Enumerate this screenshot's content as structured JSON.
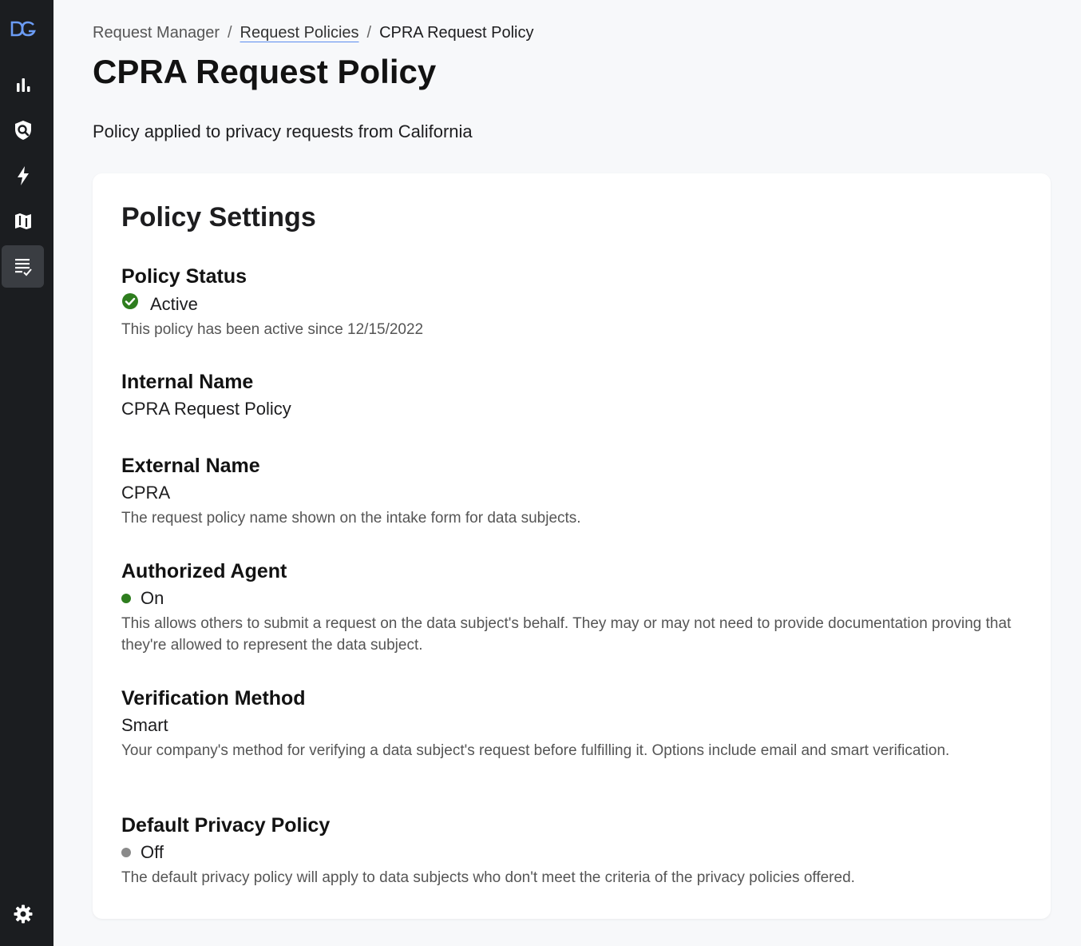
{
  "colors": {
    "sidebar_bg": "#1b1d20",
    "accent": "#5b8def",
    "status_active": "#2e7d1e",
    "status_off": "#8a8a8a"
  },
  "sidebar": {
    "logo_icon": "dg-logo-icon",
    "items": [
      {
        "icon": "bar-chart-icon",
        "active": false
      },
      {
        "icon": "shield-search-icon",
        "active": false
      },
      {
        "icon": "lightning-icon",
        "active": false
      },
      {
        "icon": "map-icon",
        "active": false
      },
      {
        "icon": "checklist-icon",
        "active": true
      }
    ],
    "footer_icon": "gear-icon"
  },
  "breadcrumb": {
    "root": "Request Manager",
    "parent": "Request Policies",
    "current": "CPRA Request Policy",
    "separator": "/"
  },
  "page": {
    "title": "CPRA Request Policy",
    "description": "Policy applied to privacy requests from California"
  },
  "settings": {
    "title": "Policy Settings",
    "status": {
      "label": "Policy Status",
      "value": "Active",
      "help": "This policy has been active since 12/15/2022"
    },
    "internal_name": {
      "label": "Internal Name",
      "value": "CPRA Request Policy"
    },
    "external_name": {
      "label": "External Name",
      "value": "CPRA",
      "help": "The request policy name shown on the intake form for data subjects."
    },
    "authorized_agent": {
      "label": "Authorized Agent",
      "value": "On",
      "help": "This allows others to submit a request on the data subject's behalf. They may or may not need to provide documentation proving that they're allowed to represent the data subject."
    },
    "verification_method": {
      "label": "Verification Method",
      "value": "Smart",
      "help": "Your company's method for verifying a data subject's request before fulfilling it. Options include email and smart verification."
    },
    "default_privacy_policy": {
      "label": "Default Privacy Policy",
      "value": "Off",
      "help": "The default privacy policy will apply to data subjects who don't meet the criteria of the privacy policies offered."
    }
  }
}
